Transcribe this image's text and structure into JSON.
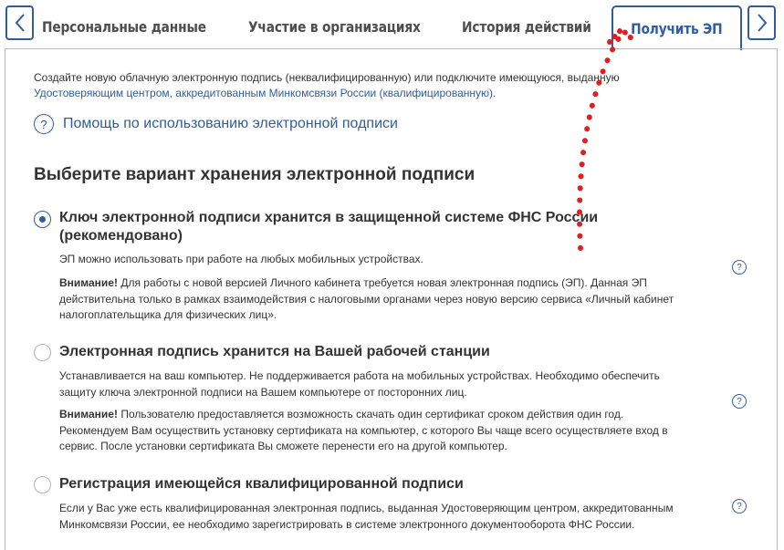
{
  "tabs": {
    "left_arrow": "‹",
    "right_arrow": "›",
    "items": [
      {
        "label": "Персональные данные"
      },
      {
        "label": "Участие в организациях"
      },
      {
        "label": "История действий"
      },
      {
        "label": "Получить ЭП"
      }
    ]
  },
  "intro": {
    "text": "Создайте новую облачную электронную подпись (неквалифицированную) или подключите имеющуюся, выданную",
    "link": "Удостоверяющим центром, аккредитованным Минкомсвязи России (квалифицированную)."
  },
  "help": {
    "icon": "?",
    "label": "Помощь по использованию электронной подписи"
  },
  "section_title": "Выберите вариант хранения электронной подписи",
  "options": [
    {
      "title_line1": "Ключ электронной подписи хранится в защищенной системе ФНС России",
      "title_line2": "(рекомендовано)",
      "desc": "ЭП можно использовать при работе на любых мобильных устройствах.",
      "warn_label": "Внимание!",
      "warn_line1": " Для работы с новой версией Личного кабинета требуется новая электронная подпись (ЭП). Данная ЭП",
      "warn_line2": "действительна только в рамках взаимодействия с налоговыми органами через новую версию сервиса  «Личный кабинет",
      "warn_line3": "налогоплательщика для физических лиц».",
      "selected": true
    },
    {
      "title_line1": "Электронная подпись хранится на Вашей рабочей станции",
      "desc_line1": "Устанавливается на ваш компьютер. Не поддерживается работа на мобильных устройствах. Необходимо обеспечить",
      "desc_line2": "защиту ключа электронной подписи на Вашем компьютере от посторонних лиц.",
      "warn_label": "Внимание!",
      "warn_line1": " Пользователю предоставляется возможность скачать один сертификат  сроком действия один год.",
      "warn_line2": "Рекомендуем Вам осуществить установку сертификата на компьютер, с которого Вы  чаще всего осуществляете вход в",
      "warn_line3": "сервис. После установки сертификата Вы сможете перенести его на другой  компьютер.",
      "selected": false
    },
    {
      "title_line1": "Регистрация имеющейся квалифицированной подписи",
      "desc_line1": "Если у Вас уже есть квалифицированная электронная подпись, выданная Удостоверяющим центром, аккредитованным",
      "desc_line2": "Минкомсвязи России, ее необходимо зарегистрировать в системе электронного документооборота ФНС России.",
      "selected": false
    }
  ],
  "hint_icon": "?",
  "colors": {
    "accent": "#2f5d9e",
    "panel_border": "#9ec0e3",
    "annotation_red": "#e02020"
  }
}
